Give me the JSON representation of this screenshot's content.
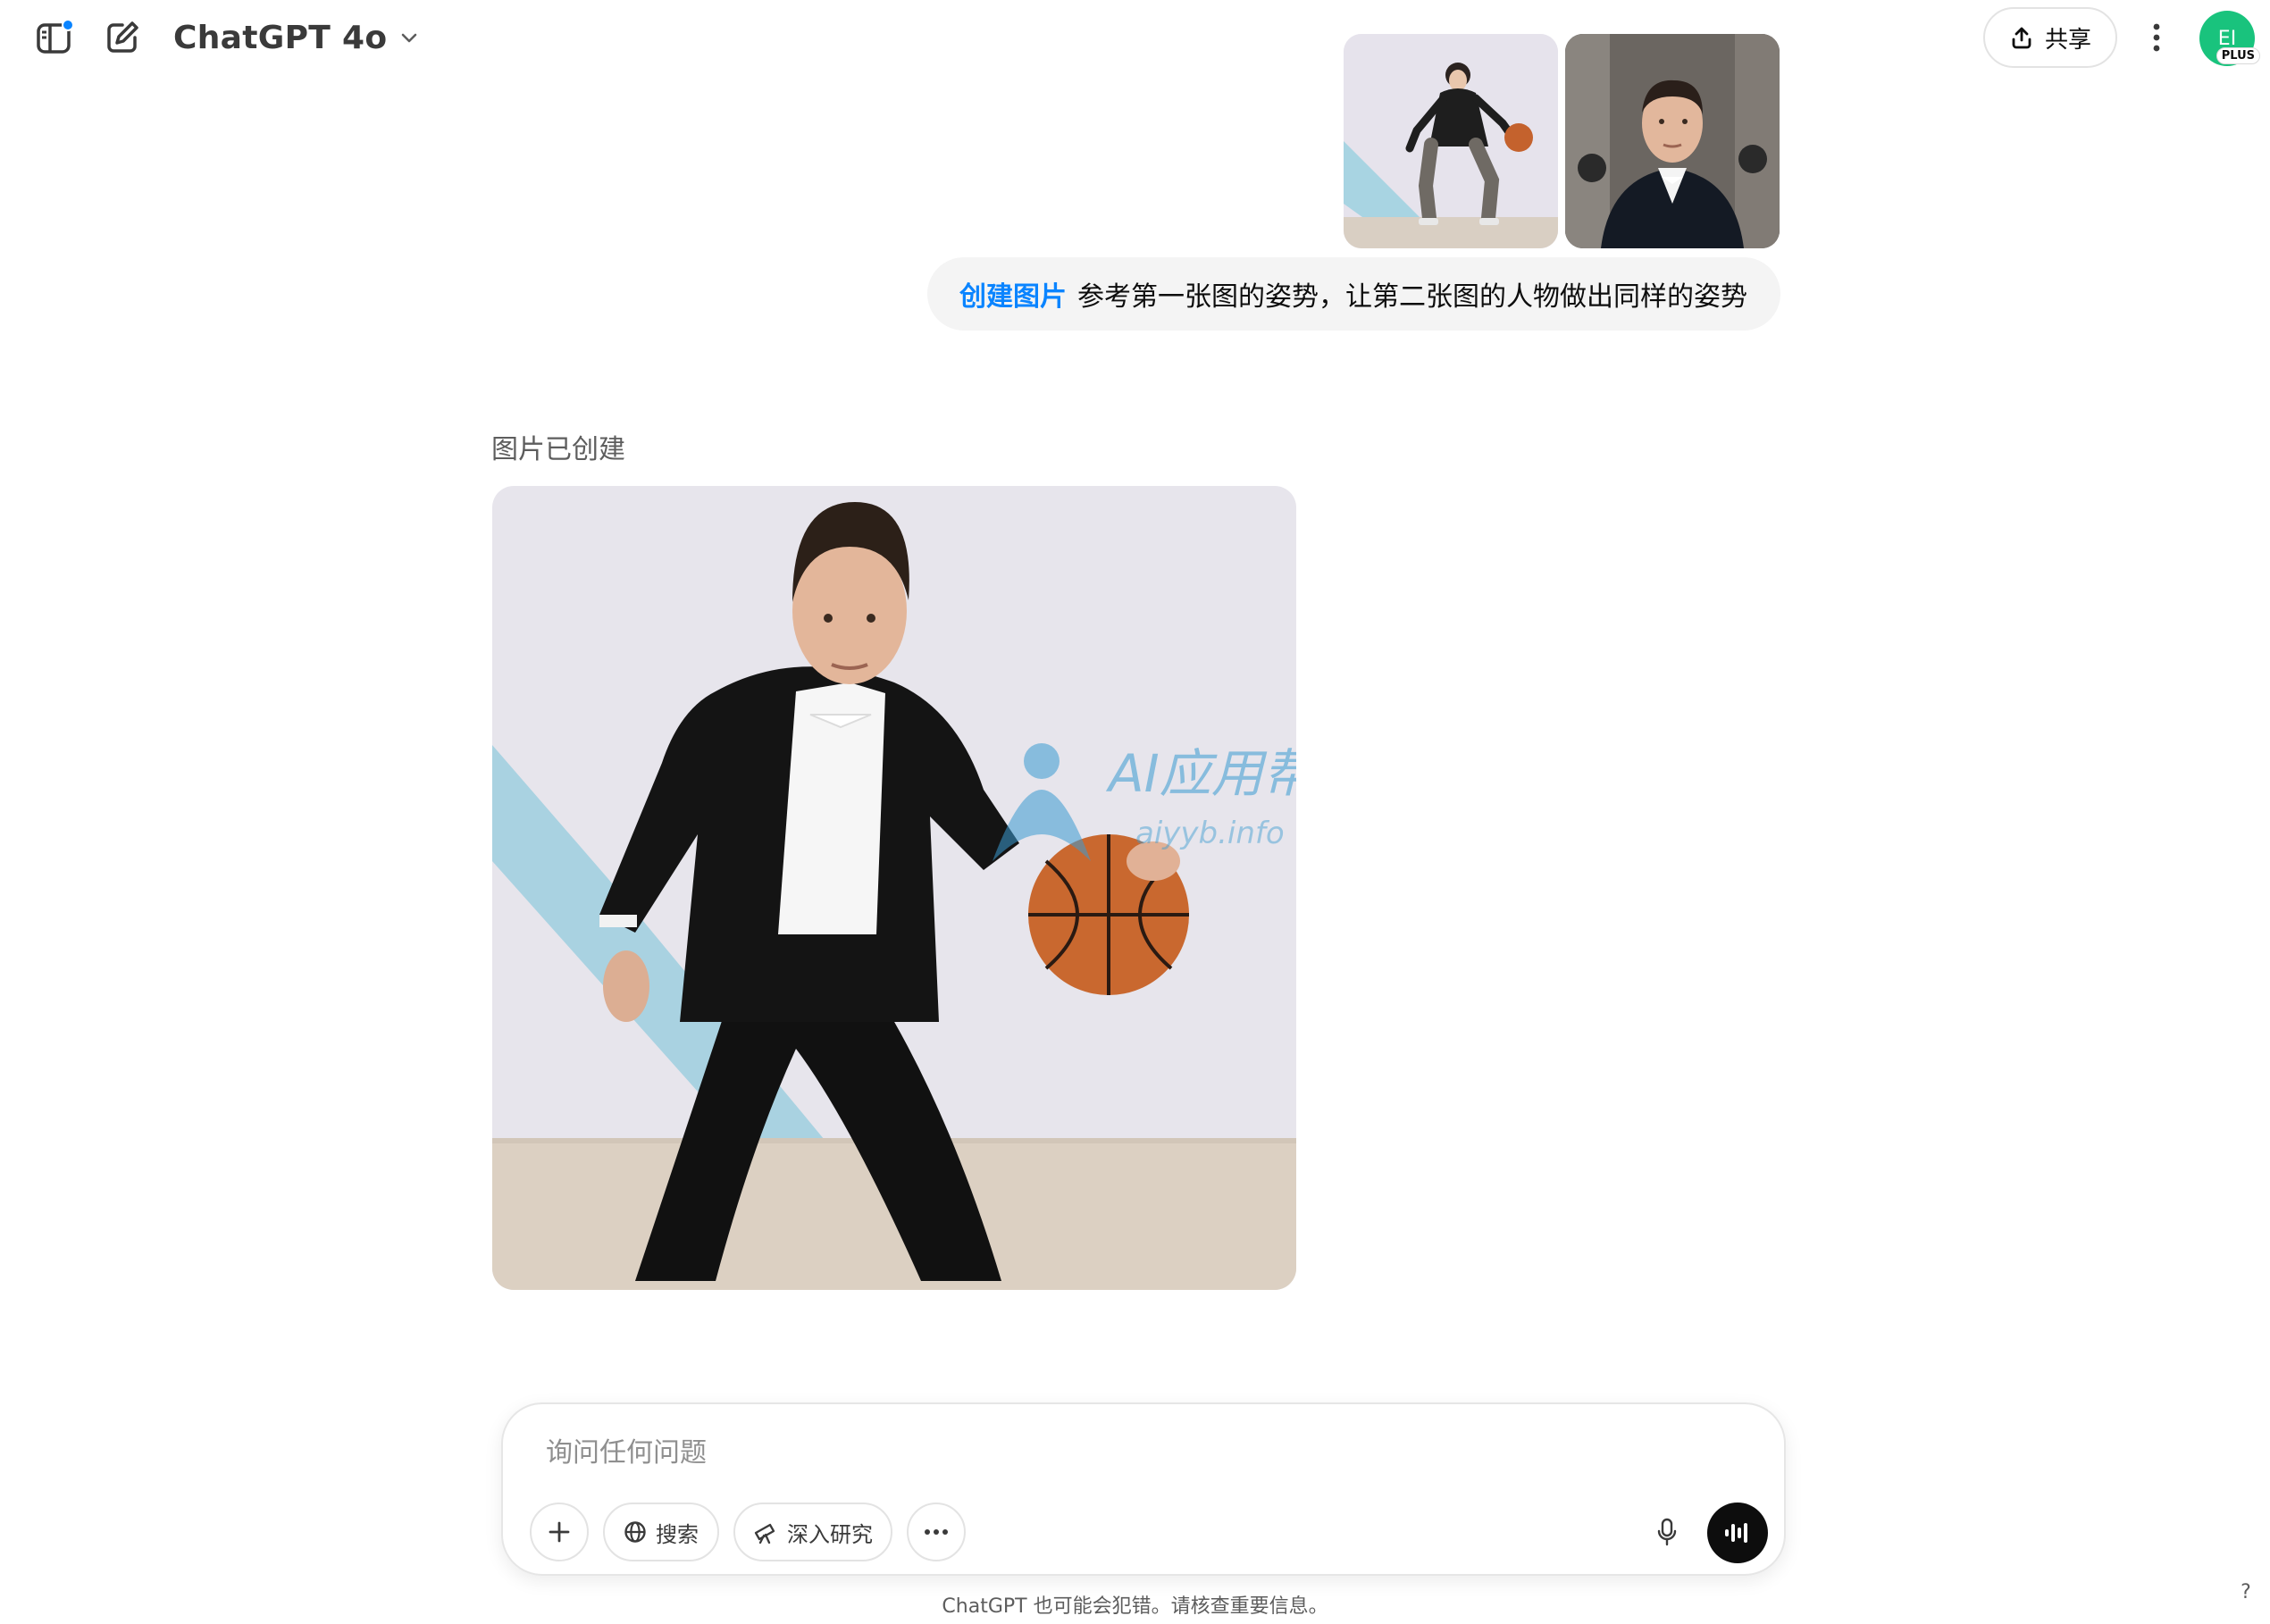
{
  "header": {
    "model_name": "ChatGPT 4o",
    "share_label": "共享",
    "avatar_initials": "EI",
    "plan_badge": "PLUS"
  },
  "user_message": {
    "tag": "创建图片",
    "text": "参考第一张图的姿势，让第二张图的人物做出同样的姿势"
  },
  "assistant_message": {
    "status": "图片已创建",
    "watermark_title": "AI应用帮",
    "watermark_subtitle": "aiyyb.info"
  },
  "composer": {
    "placeholder": "询问任何问题",
    "search_label": "搜索",
    "research_label": "深入研究"
  },
  "footer": {
    "disclaimer": "ChatGPT 也可能会犯错。请核查重要信息。",
    "help": "?"
  },
  "colors": {
    "accent": "#0a84ff",
    "avatar": "#19c37d",
    "bubble": "#f4f4f4",
    "voice_button": "#0d0d0d"
  },
  "icons": [
    "sidebar-toggle-icon",
    "new-chat-icon",
    "chevron-down-icon",
    "share-icon",
    "more-vertical-icon",
    "plus-icon",
    "globe-icon",
    "telescope-icon",
    "more-horizontal-icon",
    "microphone-icon",
    "voice-wave-icon"
  ]
}
